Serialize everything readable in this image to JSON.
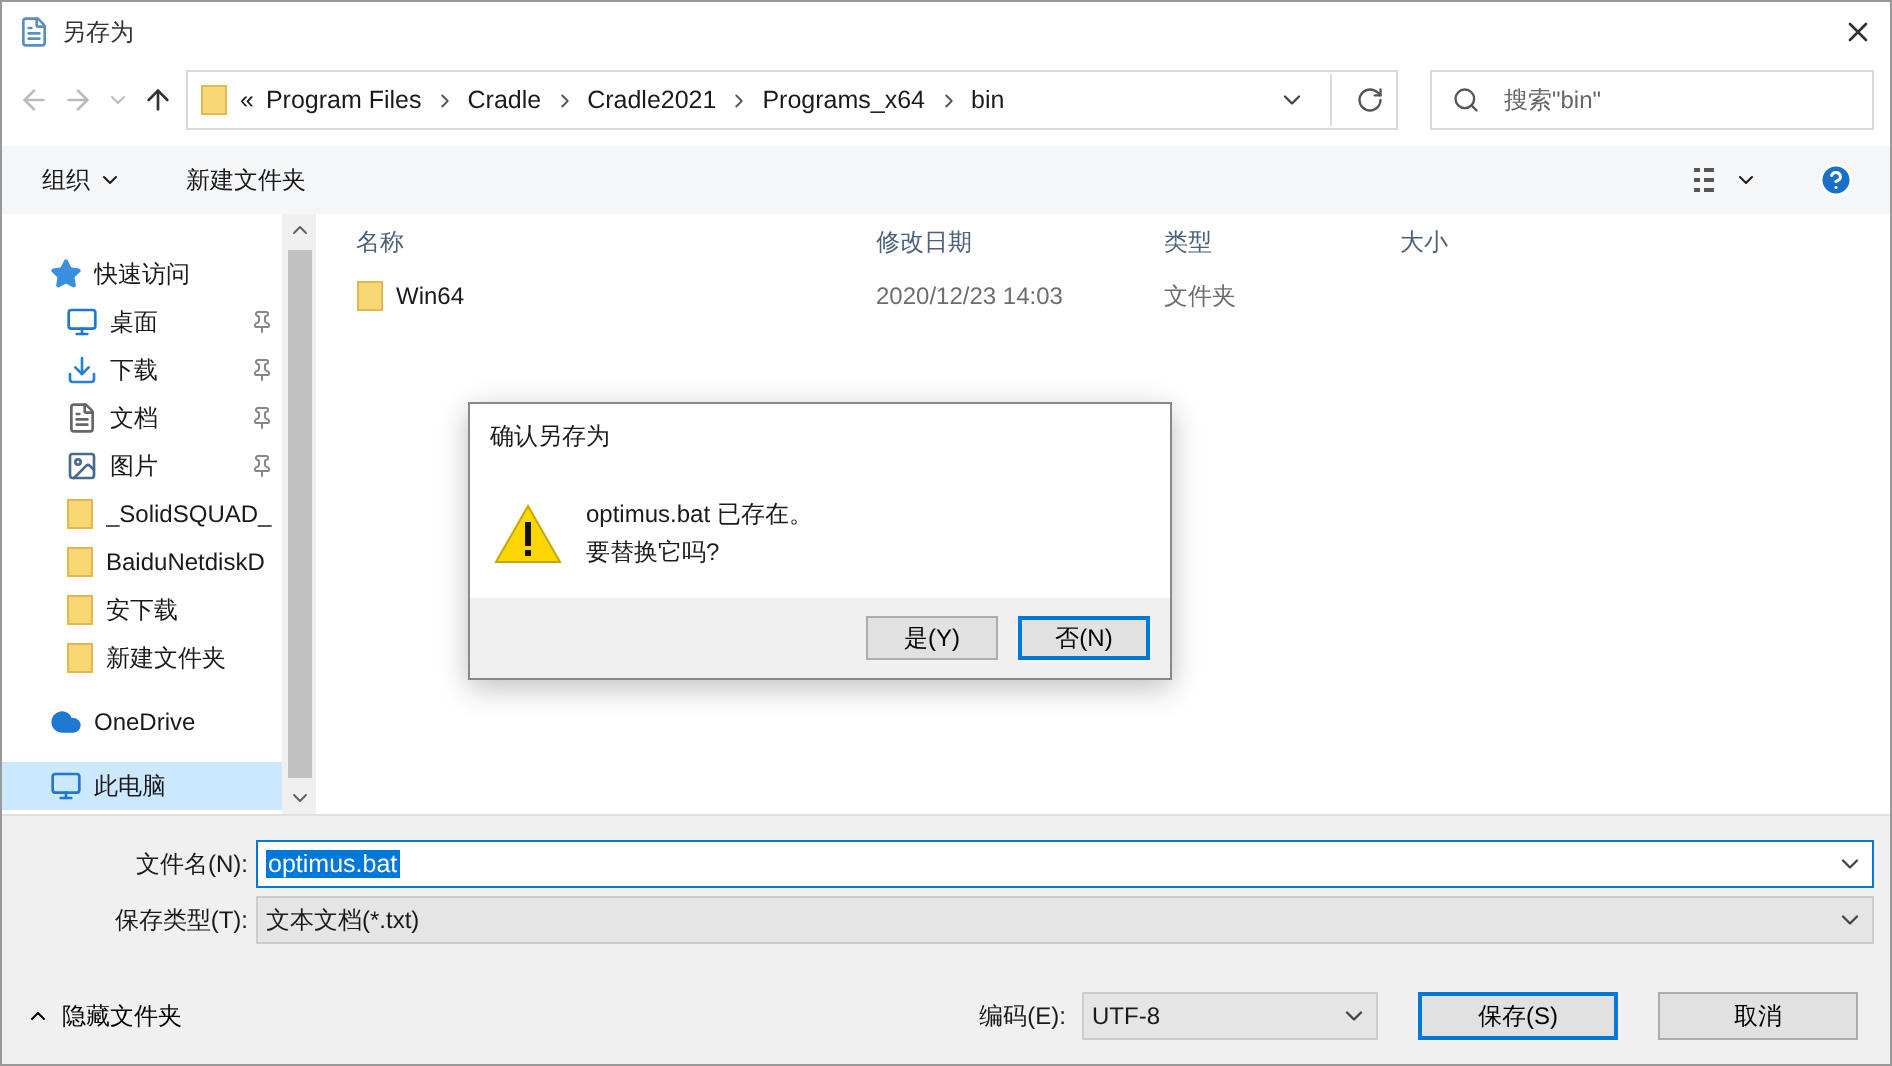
{
  "window": {
    "title": "另存为"
  },
  "address": {
    "overflow": "«",
    "crumbs": [
      "Program Files",
      "Cradle",
      "Cradle2021",
      "Programs_x64",
      "bin"
    ]
  },
  "search": {
    "placeholder": "搜索\"bin\""
  },
  "toolbar": {
    "organize": "组织",
    "new_folder": "新建文件夹"
  },
  "sidebar": {
    "items": [
      {
        "label": "快速访问",
        "kind": "star",
        "pinned": false,
        "selected": false,
        "group": true
      },
      {
        "label": "桌面",
        "kind": "desktop",
        "pinned": true,
        "selected": false,
        "group": false
      },
      {
        "label": "下载",
        "kind": "download",
        "pinned": true,
        "selected": false,
        "group": false
      },
      {
        "label": "文档",
        "kind": "document",
        "pinned": true,
        "selected": false,
        "group": false
      },
      {
        "label": "图片",
        "kind": "picture",
        "pinned": true,
        "selected": false,
        "group": false
      },
      {
        "label": "_SolidSQUAD_",
        "kind": "folder",
        "pinned": false,
        "selected": false,
        "group": false
      },
      {
        "label": "BaiduNetdiskD",
        "kind": "folder",
        "pinned": false,
        "selected": false,
        "group": false
      },
      {
        "label": "安下载",
        "kind": "folder",
        "pinned": false,
        "selected": false,
        "group": false
      },
      {
        "label": "新建文件夹",
        "kind": "folder",
        "pinned": false,
        "selected": false,
        "group": false
      },
      {
        "label": "OneDrive",
        "kind": "cloud",
        "pinned": false,
        "selected": false,
        "group": true
      },
      {
        "label": "此电脑",
        "kind": "computer",
        "pinned": false,
        "selected": true,
        "group": true
      }
    ]
  },
  "table": {
    "columns": [
      "名称",
      "修改日期",
      "类型",
      "大小"
    ],
    "rows": [
      {
        "name": "Win64",
        "modified": "2020/12/23 14:03",
        "type": "文件夹",
        "size": ""
      }
    ]
  },
  "filename": {
    "label": "文件名(N):",
    "value": "optimus.bat"
  },
  "filetype": {
    "label": "保存类型(T):",
    "value": "文本文档(*.txt)"
  },
  "hide_folders": "隐藏文件夹",
  "encoding": {
    "label": "编码(E):",
    "value": "UTF-8"
  },
  "buttons": [
    "保存(S)",
    "取消"
  ],
  "dialog": {
    "title": "确认另存为",
    "message_lines": [
      "optimus.bat 已存在。",
      "要替换它吗?"
    ],
    "buttons": [
      {
        "label": "是(Y)",
        "selected": false
      },
      {
        "label": "否(N)",
        "selected": true
      }
    ]
  }
}
